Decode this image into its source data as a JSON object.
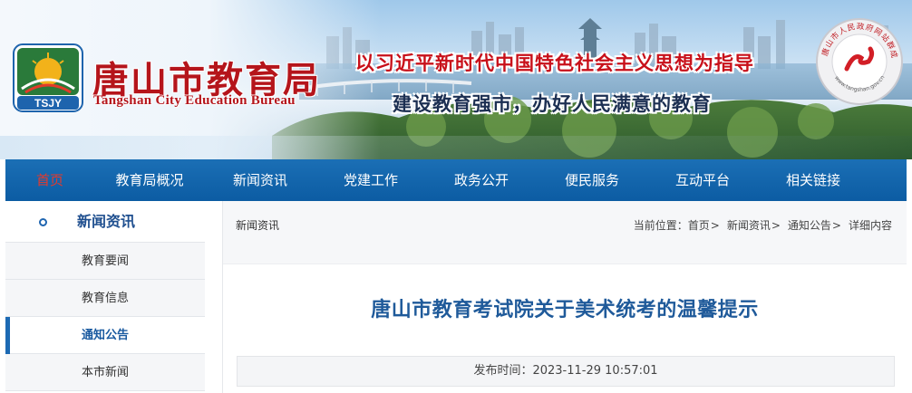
{
  "header": {
    "logo_text": "TSJY",
    "title_cn": "唐山市教育局",
    "title_en": "Tangshan City Education Bureau",
    "slogan_1": "以习近平新时代中国特色社会主义思想为指导",
    "slogan_2": "建设教育强市，办好人民满意的教育",
    "seal_text": "唐山市人民政府网站群成员",
    "seal_url": "www.tangshan.gov.cn"
  },
  "nav": {
    "items": [
      {
        "label": "首页"
      },
      {
        "label": "教育局概况"
      },
      {
        "label": "新闻资讯"
      },
      {
        "label": "党建工作"
      },
      {
        "label": "政务公开"
      },
      {
        "label": "便民服务"
      },
      {
        "label": "互动平台"
      },
      {
        "label": "相关链接"
      }
    ],
    "active_color": "#e53a2c",
    "bar_color": "#0c5ca3"
  },
  "sidebar": {
    "heading": "新闻资讯",
    "items": [
      {
        "label": "教育要闻"
      },
      {
        "label": "教育信息"
      },
      {
        "label": "通知公告",
        "active": true
      },
      {
        "label": "本市新闻"
      }
    ]
  },
  "breadcrumb": {
    "section": "新闻资讯",
    "prefix": "当前位置：",
    "path": [
      "首页",
      "新闻资讯",
      "通知公告",
      "详细内容"
    ],
    "separator": ">"
  },
  "article": {
    "title": "唐山市教育考试院关于美术统考的温馨提示",
    "publish_label": "发布时间：",
    "publish_time": "2023-11-29 10:57:01"
  }
}
